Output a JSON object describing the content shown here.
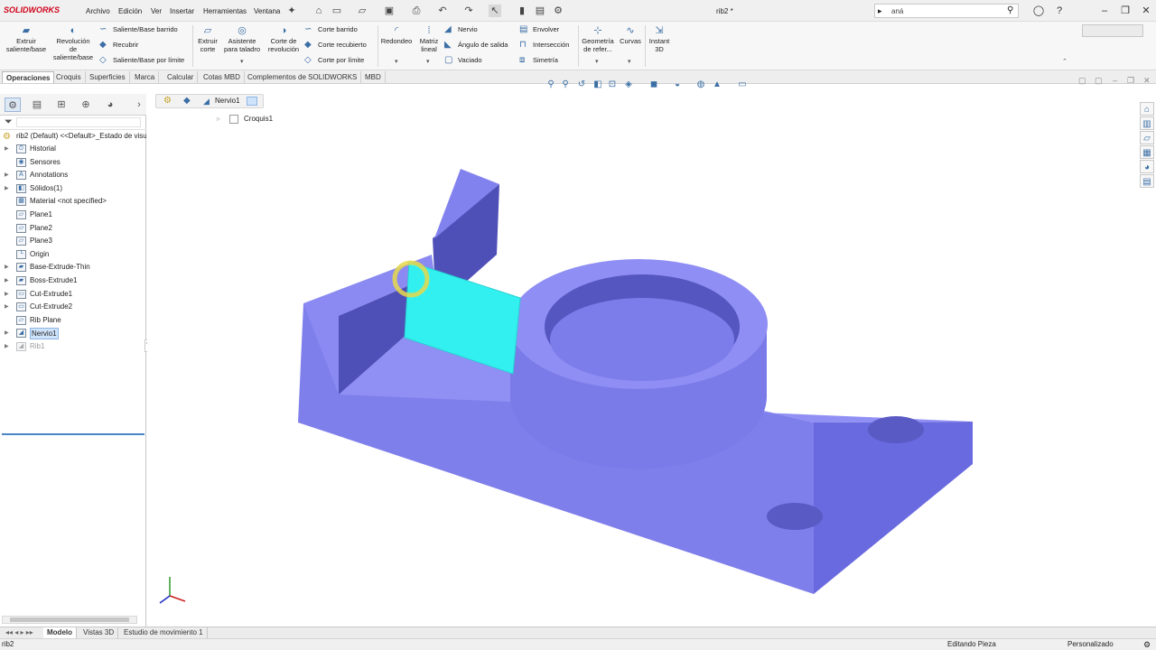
{
  "app": {
    "logo": "SOLIDWORKS",
    "doc_title": "rib2 *"
  },
  "menu": [
    "Archivo",
    "Edición",
    "Ver",
    "Insertar",
    "Herramientas",
    "Ventana"
  ],
  "search": {
    "value": "aná"
  },
  "commands": {
    "extruir_saliente": "Extruir saliente/base",
    "revolucion": "Revolución de saliente/base",
    "saliente_barrido": "Saliente/Base barrido",
    "recubrir": "Recubrir",
    "saliente_limite": "Saliente/Base por límite",
    "extruir_corte": "Extruir corte",
    "asistente_taladro": "Asistente para taladro",
    "corte_revolucion": "Corte de revolución",
    "corte_barrido": "Corte barrido",
    "corte_recubierto": "Corte recubierto",
    "corte_limite": "Corte por límite",
    "redondeo": "Redondeo",
    "matriz_lineal": "Matriz lineal",
    "nervio": "Nervio",
    "angulo_salida": "Ángulo de salida",
    "vaciado": "Vaciado",
    "envolver": "Envolver",
    "interseccion": "Intersección",
    "simetria": "Simetría",
    "geometria_ref": "Geometría de refer...",
    "curvas": "Curvas",
    "instant3d": "Instant 3D"
  },
  "tabs": [
    "Operaciones",
    "Croquis",
    "Superficies",
    "Marca",
    "Calcular",
    "Cotas MBD",
    "Complementos de SOLIDWORKS",
    "MBD"
  ],
  "tree": {
    "root": "rib2 (Default) <<Default>_Estado de visu",
    "items": [
      {
        "label": "Historial",
        "expandable": true,
        "icon": "history-icon"
      },
      {
        "label": "Sensores",
        "expandable": false,
        "icon": "sensor-icon"
      },
      {
        "label": "Annotations",
        "expandable": true,
        "icon": "annotation-icon"
      },
      {
        "label": "Sólidos(1)",
        "expandable": true,
        "icon": "solid-bodies-icon"
      },
      {
        "label": "Material <not specified>",
        "expandable": false,
        "icon": "material-icon"
      },
      {
        "label": "Plane1",
        "expandable": false,
        "icon": "plane-icon"
      },
      {
        "label": "Plane2",
        "expandable": false,
        "icon": "plane-icon"
      },
      {
        "label": "Plane3",
        "expandable": false,
        "icon": "plane-icon"
      },
      {
        "label": "Origin",
        "expandable": false,
        "icon": "origin-icon"
      },
      {
        "label": "Base-Extrude-Thin",
        "expandable": true,
        "icon": "extrude-icon"
      },
      {
        "label": "Boss-Extrude1",
        "expandable": true,
        "icon": "extrude-icon"
      },
      {
        "label": "Cut-Extrude1",
        "expandable": true,
        "icon": "cut-icon"
      },
      {
        "label": "Cut-Extrude2",
        "expandable": true,
        "icon": "cut-icon"
      },
      {
        "label": "Rib Plane",
        "expandable": false,
        "icon": "plane-icon"
      },
      {
        "label": "Nervio1",
        "expandable": true,
        "icon": "rib-icon",
        "selected": true
      },
      {
        "label": "Rib1",
        "expandable": true,
        "icon": "rib-icon",
        "dimmed": true
      }
    ]
  },
  "breadcrumb": {
    "feature": "Nervio1",
    "sketch": "Croquis1"
  },
  "bottom_tabs": [
    "Modelo",
    "Vistas 3D",
    "Estudio de movimiento 1"
  ],
  "status": {
    "left": "rib2",
    "mode": "Editando Pieza",
    "units": "Personalizado"
  },
  "colors": {
    "part": "#8c8cf4",
    "rib_highlight": "#33f0f0",
    "accent": "#d0021b"
  }
}
